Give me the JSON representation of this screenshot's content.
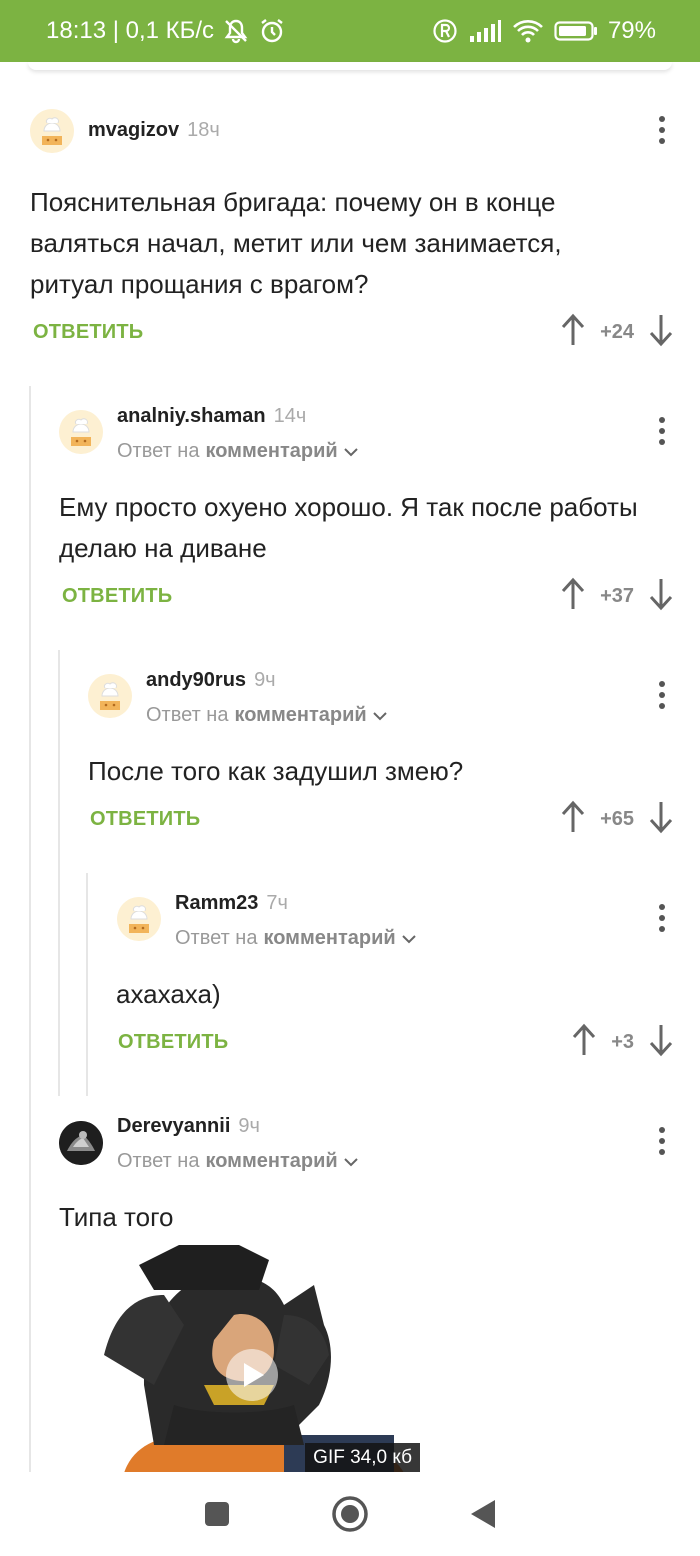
{
  "status_bar": {
    "time_speed": "18:13 | 0,1 КБ/с",
    "battery": "79%",
    "icons": [
      "mute-icon",
      "alarm-icon",
      "roaming-icon",
      "signal-icon",
      "wifi-icon",
      "battery-icon"
    ]
  },
  "common": {
    "reply_label": "ОТВЕТИТЬ",
    "reply_to_prefix": "Ответ на",
    "reply_to_link": "комментарий"
  },
  "comments": [
    {
      "author": "mvagizov",
      "time": "18ч",
      "text": "Пояснительная бригада: почему он в конце валяться начал, метит или чем занимается, ритуал прощания с врагом?",
      "score": "+24"
    },
    {
      "author": "analniy.shaman",
      "time": "14ч",
      "text": "Ему просто охуено хорошо. Я так после работы делаю на диване",
      "score": "+37"
    },
    {
      "author": "andy90rus",
      "time": "9ч",
      "text": "После того как задушил змею?",
      "score": "+65"
    },
    {
      "author": "Ramm23",
      "time": "7ч",
      "text": "ахахаха)",
      "score": "+3"
    },
    {
      "author": "Derevyannii",
      "time": "9ч",
      "text": "Типа того",
      "gif_label": "GIF 34,0 кб"
    }
  ],
  "colors": {
    "accent": "#7cb342",
    "status_bar": "#7cb342"
  }
}
